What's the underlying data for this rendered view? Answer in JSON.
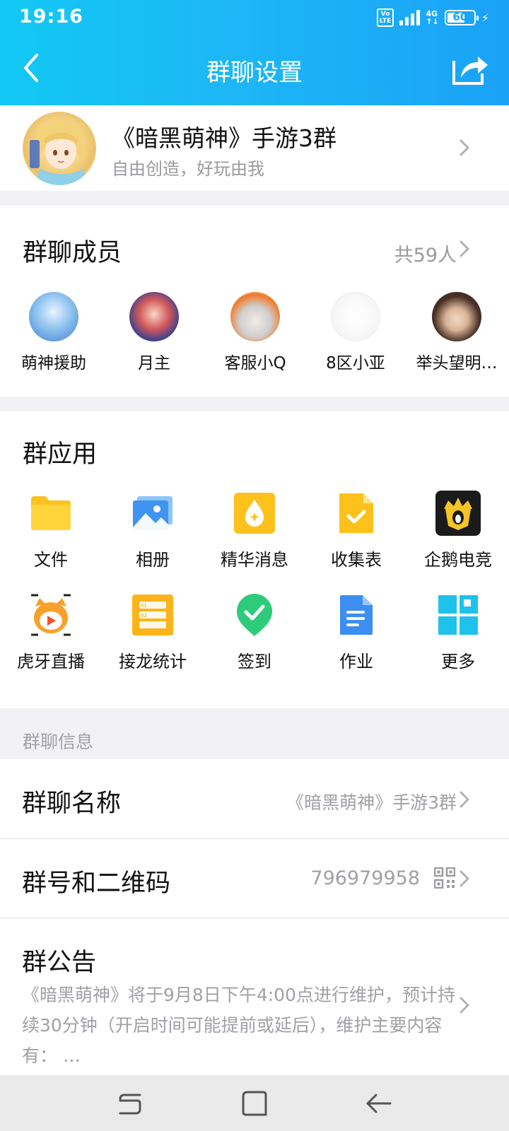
{
  "status_bar": {
    "time": "19:16",
    "volte_line1": "Vo",
    "volte_line2": "LTE",
    "net_line1": "4G",
    "net_line2": "↑↓",
    "battery": "60",
    "charging_icon": "⚡"
  },
  "header": {
    "title": "群聊设置",
    "back_icon": "chevron-left-icon",
    "share_icon": "share-icon"
  },
  "group": {
    "name": "《暗黑萌神》手游3群",
    "description": "自由创造，好玩由我"
  },
  "members": {
    "title": "群聊成员",
    "count": "共59人",
    "list": [
      {
        "name": "萌神援助"
      },
      {
        "name": "月主"
      },
      {
        "name": "客服小Q"
      },
      {
        "name": "8区小亚"
      },
      {
        "name": "举头望明…"
      }
    ]
  },
  "apps": {
    "title": "群应用",
    "items": [
      {
        "label": "文件",
        "icon": "folder-icon"
      },
      {
        "label": "相册",
        "icon": "album-icon"
      },
      {
        "label": "精华消息",
        "icon": "essence-icon"
      },
      {
        "label": "收集表",
        "icon": "form-icon"
      },
      {
        "label": "企鹅电竞",
        "icon": "penguin-esports-icon"
      },
      {
        "label": "虎牙直播",
        "icon": "huya-live-icon"
      },
      {
        "label": "接龙统计",
        "icon": "list-stats-icon"
      },
      {
        "label": "签到",
        "icon": "check-in-icon"
      },
      {
        "label": "作业",
        "icon": "homework-icon"
      },
      {
        "label": "更多",
        "icon": "more-grid-icon"
      }
    ]
  },
  "info": {
    "section_label": "群聊信息",
    "name_row": {
      "label": "群聊名称",
      "value": "《暗黑萌神》手游3群"
    },
    "number_row": {
      "label": "群号和二维码",
      "value": "796979958"
    },
    "notice_row": {
      "label": "群公告",
      "text": "《暗黑萌神》将于9月8日下午4:00点进行维护，预计持续30分钟（开启时间可能提前或延后），维护主要内容有：  …"
    }
  },
  "colors": {
    "header_start": "#12c8f4",
    "header_end": "#1aa2f7",
    "secondary_text": "#a0a0a6"
  }
}
